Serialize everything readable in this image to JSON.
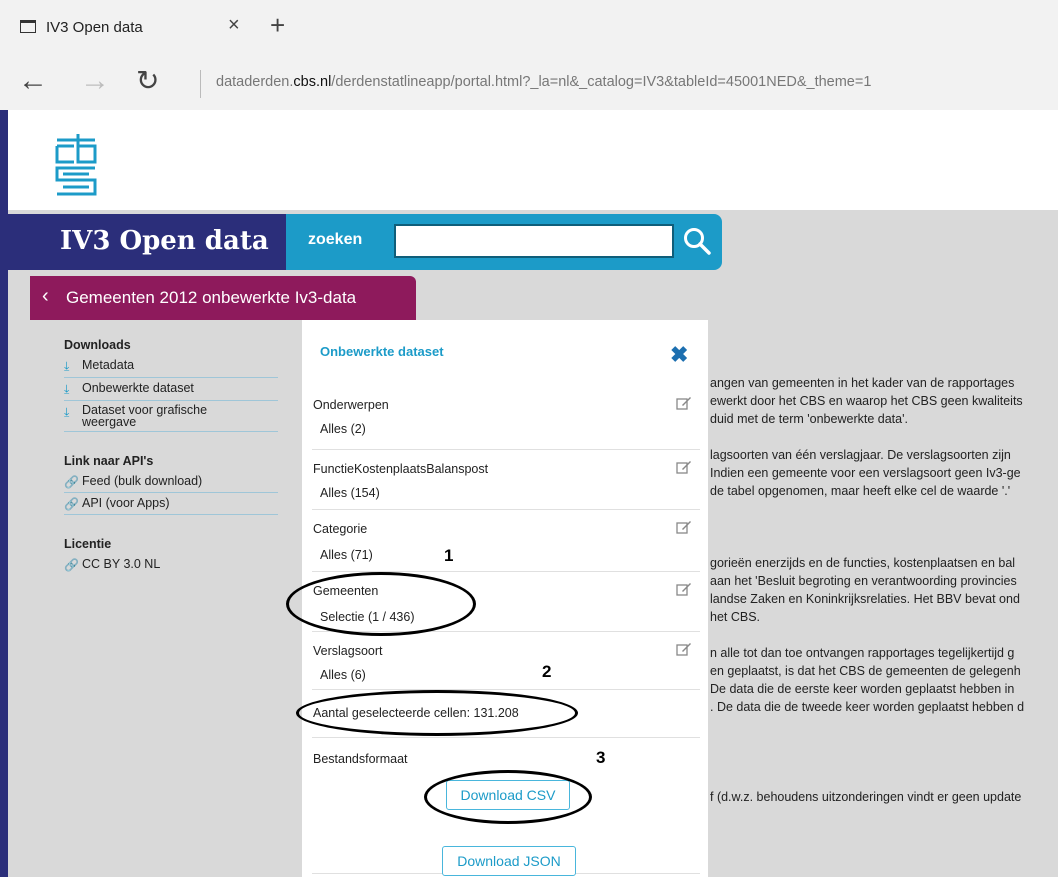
{
  "browser": {
    "tab_title": "IV3 Open data",
    "close_glyph": "×",
    "new_tab_glyph": "+",
    "url_prefix": "dataderden.",
    "url_domain": "cbs.nl",
    "url_path": "/derdenstatlineapp/portal.html?_la=nl&_catalog=IV3&tableId=45001NED&_theme=1"
  },
  "header": {
    "brand": "IV3 Open data",
    "search_label": "zoeken",
    "search_value": "",
    "breadcrumb": "Gemeenten 2012 onbewerkte Iv3-data"
  },
  "sidebar": {
    "downloads_heading": "Downloads",
    "downloads": [
      "Metadata",
      "Onbewerkte dataset",
      "Dataset voor grafische weergave"
    ],
    "api_heading": "Link naar API's",
    "api_links": [
      "Feed (bulk download)",
      "API (voor Apps)"
    ],
    "license_heading": "Licentie",
    "license_link": "CC BY 3.0 NL"
  },
  "panel": {
    "title": "Onbewerkte dataset",
    "close_glyph": "✖",
    "sections": [
      {
        "label": "Onderwerpen",
        "value": "Alles (2)"
      },
      {
        "label": "FunctieKostenplaatsBalanspost",
        "value": "Alles (154)"
      },
      {
        "label": "Categorie",
        "value": "Alles (71)"
      },
      {
        "label": "Gemeenten",
        "value": "Selectie (1 / 436)"
      },
      {
        "label": "Verslagsoort",
        "value": "Alles (6)"
      }
    ],
    "cells_text": "Aantal geselecteerde cellen: 131.208",
    "format_label": "Bestandsformaat",
    "download_csv": "Download CSV",
    "download_json": "Download JSON"
  },
  "background_text": [
    "angen van gemeenten in het kader van de rapportages",
    "ewerkt door het CBS en waarop het CBS geen kwaliteits",
    "duid met de term 'onbewerkte data'.",
    "lagsoorten van één verslagjaar. De verslagsoorten zijn",
    "Indien een gemeente voor een verslagsoort geen Iv3-ge",
    "de tabel opgenomen, maar heeft elke cel de waarde '.'",
    "gorieën enerzijds en de functies, kostenplaatsen en bal",
    "aan het 'Besluit begroting en verantwoording provincies",
    "landse Zaken en Koninkrijksrelaties. Het BBV bevat ond",
    "het CBS.",
    "n alle tot dan toe ontvangen rapportages tegelijkertijd g",
    "en geplaatst, is dat het CBS de gemeenten de gelegenh",
    "De data die de eerste keer worden geplaatst hebben in",
    ". De data die de tweede keer worden geplaatst hebben d",
    "f (d.w.z. behoudens uitzonderingen vindt er geen update"
  ],
  "annotations": [
    "1",
    "2",
    "3"
  ],
  "colors": {
    "brand_navy": "#2b2e7a",
    "search_blue": "#1c9bc8",
    "breadcrumb_magenta": "#8e1a5c",
    "page_gray": "#d9d9d9"
  }
}
